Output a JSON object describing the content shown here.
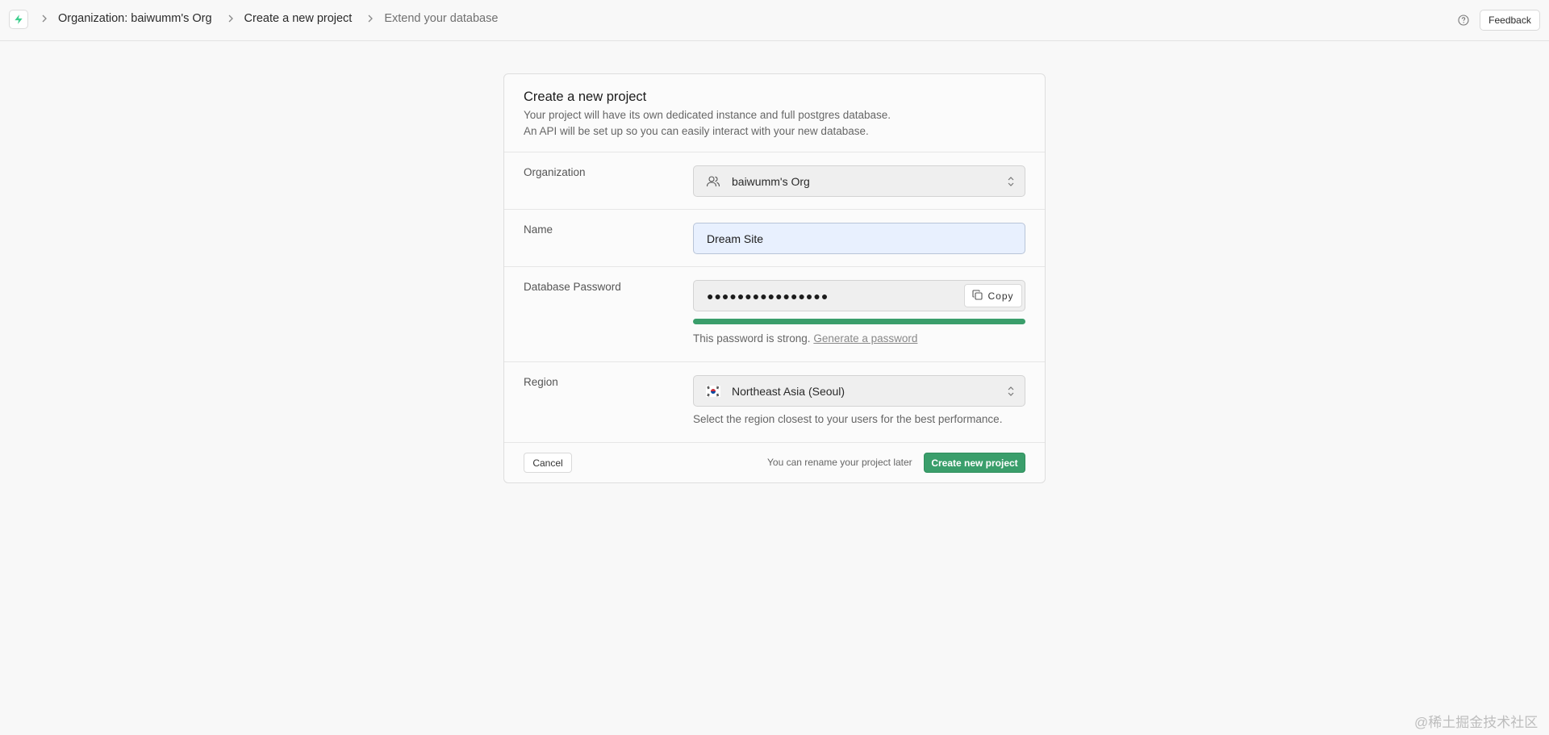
{
  "breadcrumb": {
    "items": [
      {
        "label": "Organization: baiwumm's Org"
      },
      {
        "label": "Create a new project"
      },
      {
        "label": "Extend your database"
      }
    ]
  },
  "header": {
    "feedback_label": "Feedback",
    "logo_icon": "supabase-bolt-icon",
    "help_icon": "help-circle-icon"
  },
  "form": {
    "title": "Create a new project",
    "description_line1": "Your project will have its own dedicated instance and full postgres database.",
    "description_line2": "An API will be set up so you can easily interact with your new database.",
    "organization": {
      "label": "Organization",
      "value": "baiwumm's Org",
      "icon": "users-icon"
    },
    "name": {
      "label": "Name",
      "value": "Dream Site"
    },
    "password": {
      "label": "Database Password",
      "masked_value": "●●●●●●●●●●●●●●●●",
      "copy_label": "Copy",
      "strength_fraction": 1.0,
      "strength_text": "This password is strong.",
      "generate_link": "Generate a password"
    },
    "region": {
      "label": "Region",
      "value": "Northeast Asia (Seoul)",
      "flag_icon": "south-korea-flag-icon",
      "helper": "Select the region closest to your users for the best performance."
    },
    "footer": {
      "cancel_label": "Cancel",
      "rename_note": "You can rename your project later",
      "create_label": "Create new project"
    }
  },
  "colors": {
    "brand_green": "#3a9e6b",
    "autofill_blue": "#e8f0fe"
  },
  "watermark": "@稀土掘金技术社区"
}
